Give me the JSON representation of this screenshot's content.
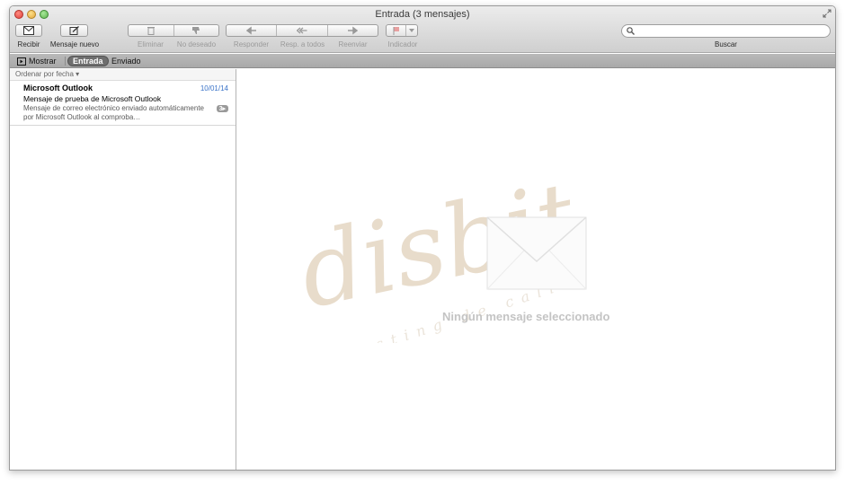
{
  "window": {
    "title": "Entrada (3 mensajes)"
  },
  "toolbar": {
    "receive_label": "Recibir",
    "new_label": "Mensaje nuevo",
    "delete_label": "Eliminar",
    "junk_label": "No deseado",
    "reply_label": "Responder",
    "reply_all_label": "Resp. a todos",
    "forward_label": "Reenviar",
    "flag_label": "Indicador",
    "search_label": "Buscar",
    "search_value": ""
  },
  "favorites": {
    "show_label": "Mostrar",
    "inbox_label": "Entrada",
    "sent_label": "Enviado"
  },
  "list": {
    "sort_label": "Ordenar por fecha",
    "messages": [
      {
        "sender": "Microsoft Outlook",
        "date": "10/01/14",
        "subject": "Mensaje de prueba de Microsoft Outlook",
        "preview": "Mensaje de correo electrónico enviado automáticamente por Microsoft Outlook al comproba…",
        "count": "3"
      }
    ]
  },
  "reader": {
    "empty_text": "Ningún mensaje seleccionado"
  },
  "watermark": {
    "brand": "disbit",
    "tagline": "Hosting de calidad"
  },
  "colors": {
    "accent_blue": "#3a73c8",
    "watermark": "#e8dccb",
    "empty_text": "#c4c4c4"
  }
}
